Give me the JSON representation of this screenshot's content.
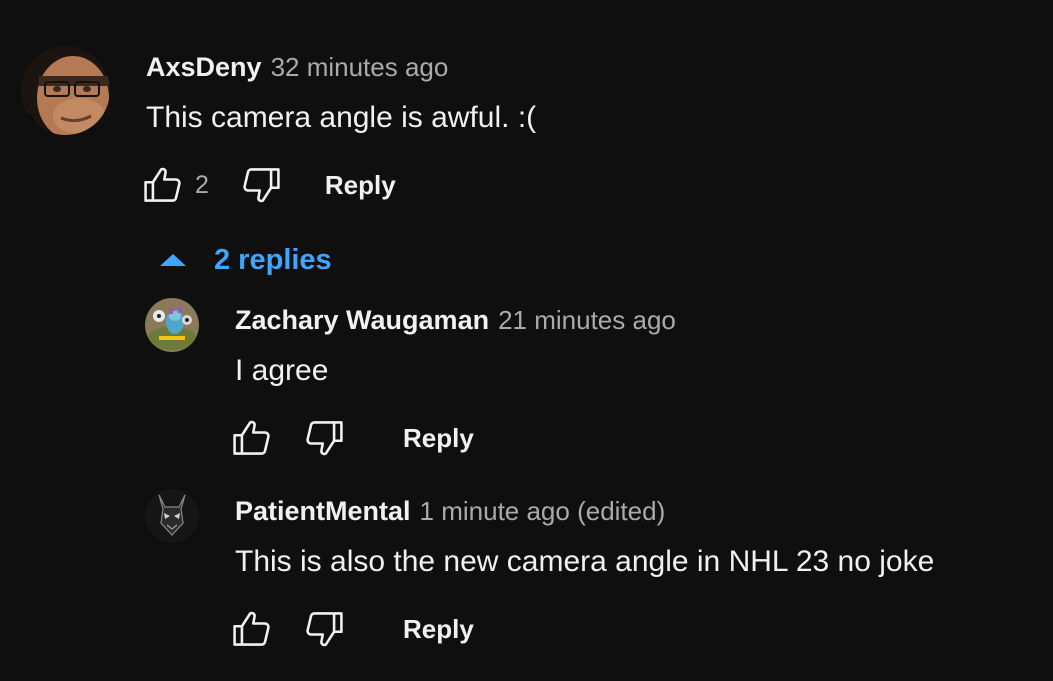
{
  "comment": {
    "author": "AxsDeny",
    "timestamp": "32 minutes ago",
    "text": "This camera angle is awful. :(",
    "likes": "2",
    "reply_label": "Reply",
    "avatar_icon": "user-avatar-photo"
  },
  "replies_toggle": {
    "label": "2 replies",
    "icon": "caret-up-icon",
    "color": "#3ea6ff"
  },
  "replies": [
    {
      "author": "Zachary Waugaman",
      "timestamp": "21 minutes ago",
      "text": "I agree",
      "reply_label": "Reply"
    },
    {
      "author": "PatientMental",
      "timestamp": "1 minute ago (edited)",
      "text": "This is also the new camera angle in NHL 23 no joke",
      "reply_label": "Reply"
    }
  ],
  "icons": {
    "like": "thumbs-up-icon",
    "dislike": "thumbs-down-icon"
  },
  "colors": {
    "background": "#0f0f0f",
    "primary_text": "#f1f1f1",
    "secondary_text": "#aaaaaa",
    "accent": "#3ea6ff"
  }
}
